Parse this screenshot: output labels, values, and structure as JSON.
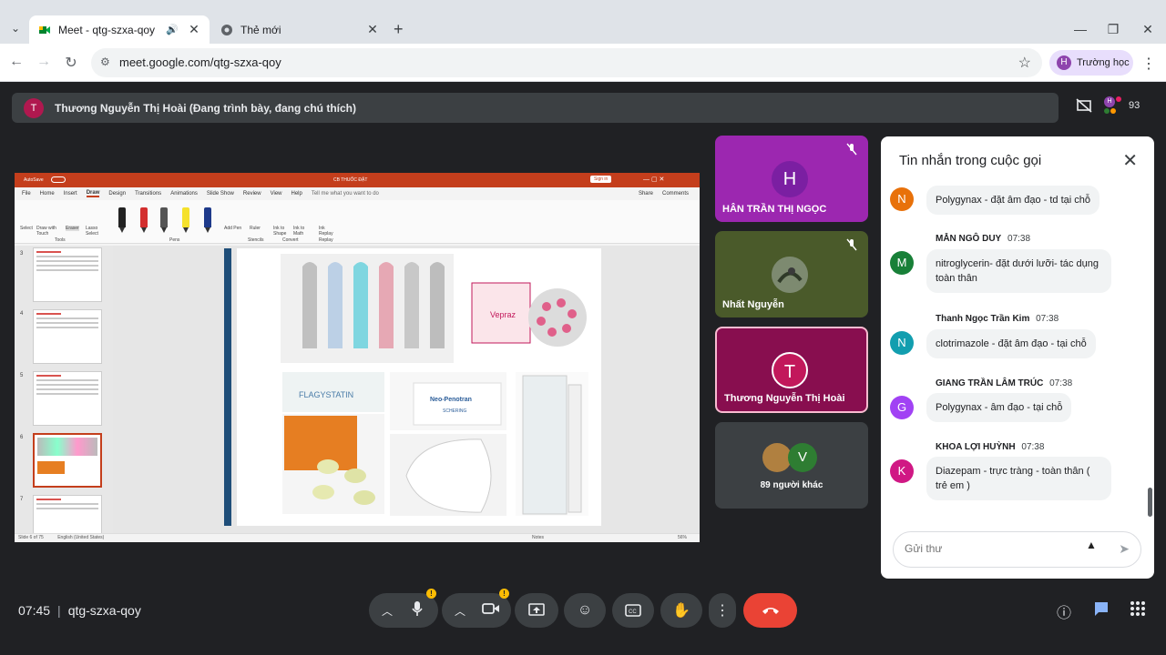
{
  "browser": {
    "tabs": [
      {
        "title": "Meet - qtg-szxa-qoy",
        "active": true,
        "audio": true
      },
      {
        "title": "Thẻ mới",
        "active": false
      }
    ],
    "url": "meet.google.com/qtg-szxa-qoy",
    "profile_name": "Trường học",
    "profile_initial": "H"
  },
  "meet": {
    "presenter_initial": "T",
    "presenter_text": "Thương Nguyễn Thị Hoài (Đang trình bày, đang chú thích)",
    "participant_count": "93",
    "time": "07:45",
    "meeting_code": "qtg-szxa-qoy",
    "tiles": [
      {
        "initial": "H",
        "name": "HÂN TRẦN THỊ NGỌC",
        "color": "#9c27b0",
        "muted": true
      },
      {
        "initial": "",
        "name": "Nhất Nguyễn",
        "color": "#4a5a2a",
        "muted": true
      },
      {
        "initial": "T",
        "name": "Thương Nguyễn Thị Hoài",
        "color": "#b0184f",
        "muted": false
      },
      {
        "initial": "V",
        "name": "89 người khác",
        "color": "#3c4043"
      }
    ]
  },
  "presentation": {
    "app_title": "CB THUỐC ĐẶT",
    "autosave": "AutoSave",
    "sign_in": "Sign in",
    "menu": [
      "File",
      "Home",
      "Insert",
      "Draw",
      "Design",
      "Transitions",
      "Animations",
      "Slide Show",
      "Review",
      "View",
      "Help"
    ],
    "tell_me": "Tell me what you want to do",
    "share": "Share",
    "comments": "Comments",
    "ribbon_tools": [
      "Select",
      "Draw with Touch",
      "Eraser",
      "Lasso Select",
      "Add Pen",
      "Ruler",
      "Ink to Shape",
      "Ink to Math",
      "Ink Replay"
    ],
    "ribbon_groups": [
      "Tools",
      "Pens",
      "Stencils",
      "Convert",
      "Replay"
    ],
    "slide_numbers": [
      "3",
      "4",
      "5",
      "6",
      "7"
    ],
    "product_labels": [
      "Vepraz",
      "FLAGYSTATIN",
      "Neo-Penotran",
      "SCHERING"
    ],
    "status_left": "Slide 6 of 75",
    "status_lang": "English (United States)",
    "status_right": "Notes",
    "zoom": "56%"
  },
  "chat": {
    "title": "Tin nhắn trong cuộc gọi",
    "input_placeholder": "Gửi thư",
    "messages": [
      {
        "initial": "N",
        "color": "#e8710a",
        "sender": "",
        "time": "",
        "text": "Polygynax - đặt âm đạo - td tại chỗ"
      },
      {
        "initial": "M",
        "color": "#188038",
        "sender": "MẪN NGÔ DUY",
        "time": "07:38",
        "text": "nitroglycerin- đặt dưới lưỡi- tác dụng toàn thân"
      },
      {
        "initial": "N",
        "color": "#129eaf",
        "sender": "Thanh Ngọc Trần Kim",
        "time": "07:38",
        "text": "clotrimazole - đặt âm đạo - tại chỗ"
      },
      {
        "initial": "G",
        "color": "#a142f4",
        "sender": "GIANG TRẦN LÂM TRÚC",
        "time": "07:38",
        "text": "Polygynax - âm đạo - tại chỗ"
      },
      {
        "initial": "K",
        "color": "#d01884",
        "sender": "KHOA LỢI HUỲNH",
        "time": "07:38",
        "text": "Diazepam - trực tràng - toàn thân ( trẻ em )"
      }
    ]
  },
  "colors": {
    "end_call": "#ea4335",
    "warning": "#fbbc04",
    "ppt_accent": "#c43e1c"
  }
}
